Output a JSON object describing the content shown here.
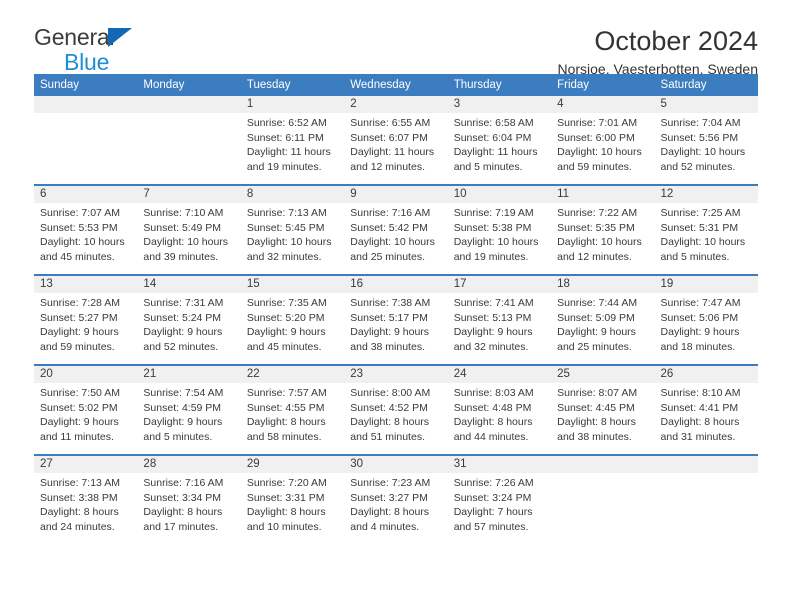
{
  "brand": {
    "line1": "General",
    "line2": "Blue",
    "triangle_color": "#1268b3",
    "line2_color": "#1e8fd5"
  },
  "header": {
    "title": "October 2024",
    "subtitle": "Norsjoe, Vaesterbotten, Sweden"
  },
  "theme": {
    "header_bg": "#3b7dc0",
    "header_text": "#ffffff",
    "daynum_bg": "#f0f0f0",
    "cell_text": "#3a3a3a"
  },
  "weekdays": [
    "Sunday",
    "Monday",
    "Tuesday",
    "Wednesday",
    "Thursday",
    "Friday",
    "Saturday"
  ],
  "weeks": [
    [
      {
        "day": "",
        "lines": []
      },
      {
        "day": "",
        "lines": []
      },
      {
        "day": "1",
        "lines": [
          "Sunrise: 6:52 AM",
          "Sunset: 6:11 PM",
          "Daylight: 11 hours",
          "and 19 minutes."
        ]
      },
      {
        "day": "2",
        "lines": [
          "Sunrise: 6:55 AM",
          "Sunset: 6:07 PM",
          "Daylight: 11 hours",
          "and 12 minutes."
        ]
      },
      {
        "day": "3",
        "lines": [
          "Sunrise: 6:58 AM",
          "Sunset: 6:04 PM",
          "Daylight: 11 hours",
          "and 5 minutes."
        ]
      },
      {
        "day": "4",
        "lines": [
          "Sunrise: 7:01 AM",
          "Sunset: 6:00 PM",
          "Daylight: 10 hours",
          "and 59 minutes."
        ]
      },
      {
        "day": "5",
        "lines": [
          "Sunrise: 7:04 AM",
          "Sunset: 5:56 PM",
          "Daylight: 10 hours",
          "and 52 minutes."
        ]
      }
    ],
    [
      {
        "day": "6",
        "lines": [
          "Sunrise: 7:07 AM",
          "Sunset: 5:53 PM",
          "Daylight: 10 hours",
          "and 45 minutes."
        ]
      },
      {
        "day": "7",
        "lines": [
          "Sunrise: 7:10 AM",
          "Sunset: 5:49 PM",
          "Daylight: 10 hours",
          "and 39 minutes."
        ]
      },
      {
        "day": "8",
        "lines": [
          "Sunrise: 7:13 AM",
          "Sunset: 5:45 PM",
          "Daylight: 10 hours",
          "and 32 minutes."
        ]
      },
      {
        "day": "9",
        "lines": [
          "Sunrise: 7:16 AM",
          "Sunset: 5:42 PM",
          "Daylight: 10 hours",
          "and 25 minutes."
        ]
      },
      {
        "day": "10",
        "lines": [
          "Sunrise: 7:19 AM",
          "Sunset: 5:38 PM",
          "Daylight: 10 hours",
          "and 19 minutes."
        ]
      },
      {
        "day": "11",
        "lines": [
          "Sunrise: 7:22 AM",
          "Sunset: 5:35 PM",
          "Daylight: 10 hours",
          "and 12 minutes."
        ]
      },
      {
        "day": "12",
        "lines": [
          "Sunrise: 7:25 AM",
          "Sunset: 5:31 PM",
          "Daylight: 10 hours",
          "and 5 minutes."
        ]
      }
    ],
    [
      {
        "day": "13",
        "lines": [
          "Sunrise: 7:28 AM",
          "Sunset: 5:27 PM",
          "Daylight: 9 hours",
          "and 59 minutes."
        ]
      },
      {
        "day": "14",
        "lines": [
          "Sunrise: 7:31 AM",
          "Sunset: 5:24 PM",
          "Daylight: 9 hours",
          "and 52 minutes."
        ]
      },
      {
        "day": "15",
        "lines": [
          "Sunrise: 7:35 AM",
          "Sunset: 5:20 PM",
          "Daylight: 9 hours",
          "and 45 minutes."
        ]
      },
      {
        "day": "16",
        "lines": [
          "Sunrise: 7:38 AM",
          "Sunset: 5:17 PM",
          "Daylight: 9 hours",
          "and 38 minutes."
        ]
      },
      {
        "day": "17",
        "lines": [
          "Sunrise: 7:41 AM",
          "Sunset: 5:13 PM",
          "Daylight: 9 hours",
          "and 32 minutes."
        ]
      },
      {
        "day": "18",
        "lines": [
          "Sunrise: 7:44 AM",
          "Sunset: 5:09 PM",
          "Daylight: 9 hours",
          "and 25 minutes."
        ]
      },
      {
        "day": "19",
        "lines": [
          "Sunrise: 7:47 AM",
          "Sunset: 5:06 PM",
          "Daylight: 9 hours",
          "and 18 minutes."
        ]
      }
    ],
    [
      {
        "day": "20",
        "lines": [
          "Sunrise: 7:50 AM",
          "Sunset: 5:02 PM",
          "Daylight: 9 hours",
          "and 11 minutes."
        ]
      },
      {
        "day": "21",
        "lines": [
          "Sunrise: 7:54 AM",
          "Sunset: 4:59 PM",
          "Daylight: 9 hours",
          "and 5 minutes."
        ]
      },
      {
        "day": "22",
        "lines": [
          "Sunrise: 7:57 AM",
          "Sunset: 4:55 PM",
          "Daylight: 8 hours",
          "and 58 minutes."
        ]
      },
      {
        "day": "23",
        "lines": [
          "Sunrise: 8:00 AM",
          "Sunset: 4:52 PM",
          "Daylight: 8 hours",
          "and 51 minutes."
        ]
      },
      {
        "day": "24",
        "lines": [
          "Sunrise: 8:03 AM",
          "Sunset: 4:48 PM",
          "Daylight: 8 hours",
          "and 44 minutes."
        ]
      },
      {
        "day": "25",
        "lines": [
          "Sunrise: 8:07 AM",
          "Sunset: 4:45 PM",
          "Daylight: 8 hours",
          "and 38 minutes."
        ]
      },
      {
        "day": "26",
        "lines": [
          "Sunrise: 8:10 AM",
          "Sunset: 4:41 PM",
          "Daylight: 8 hours",
          "and 31 minutes."
        ]
      }
    ],
    [
      {
        "day": "27",
        "lines": [
          "Sunrise: 7:13 AM",
          "Sunset: 3:38 PM",
          "Daylight: 8 hours",
          "and 24 minutes."
        ]
      },
      {
        "day": "28",
        "lines": [
          "Sunrise: 7:16 AM",
          "Sunset: 3:34 PM",
          "Daylight: 8 hours",
          "and 17 minutes."
        ]
      },
      {
        "day": "29",
        "lines": [
          "Sunrise: 7:20 AM",
          "Sunset: 3:31 PM",
          "Daylight: 8 hours",
          "and 10 minutes."
        ]
      },
      {
        "day": "30",
        "lines": [
          "Sunrise: 7:23 AM",
          "Sunset: 3:27 PM",
          "Daylight: 8 hours",
          "and 4 minutes."
        ]
      },
      {
        "day": "31",
        "lines": [
          "Sunrise: 7:26 AM",
          "Sunset: 3:24 PM",
          "Daylight: 7 hours",
          "and 57 minutes."
        ]
      },
      {
        "day": "",
        "lines": []
      },
      {
        "day": "",
        "lines": []
      }
    ]
  ]
}
